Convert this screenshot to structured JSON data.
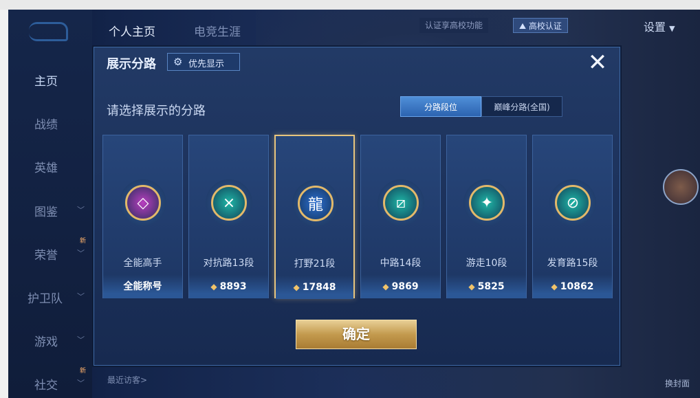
{
  "sidebar": {
    "items": [
      {
        "label": "主页"
      },
      {
        "label": "战绩"
      },
      {
        "label": "英雄"
      },
      {
        "label": "图鉴"
      },
      {
        "label": "荣誉",
        "badge": "新"
      },
      {
        "label": "护卫队"
      },
      {
        "label": "游戏"
      },
      {
        "label": "社交",
        "badge": "新"
      }
    ]
  },
  "header": {
    "tabs": [
      "个人主页",
      "电竞生涯"
    ],
    "campus_text": "认证享高校功能",
    "campus_button": "高校认证",
    "settings_label": "设置"
  },
  "footer": {
    "recent_visitors": "最近访客>",
    "change_cover": "换封面"
  },
  "modal": {
    "title": "展示分路",
    "priority_label": "优先显示",
    "prompt": "请选择展示的分路",
    "segments": {
      "active": "分路段位",
      "inactive": "巅峰分路(全国)"
    },
    "confirm_label": "确定",
    "cards": [
      {
        "name": "全能高手",
        "value": "全能称号",
        "has_points_icon": false,
        "emblem_color": "#b83fbf",
        "glyph": "◇"
      },
      {
        "name": "对抗路13段",
        "value": "8893",
        "has_points_icon": true,
        "emblem_color": "#1fb6a6",
        "glyph": "⨯"
      },
      {
        "name": "打野21段",
        "value": "17848",
        "has_points_icon": true,
        "emblem_color": "#2c6fd0",
        "glyph": "龍",
        "selected": true
      },
      {
        "name": "中路14段",
        "value": "9869",
        "has_points_icon": true,
        "emblem_color": "#1fb6a6",
        "glyph": "⧄"
      },
      {
        "name": "游走10段",
        "value": "5825",
        "has_points_icon": true,
        "emblem_color": "#1fb6a6",
        "glyph": "✦"
      },
      {
        "name": "发育路15段",
        "value": "10862",
        "has_points_icon": true,
        "emblem_color": "#1fb6a6",
        "glyph": "⊘"
      }
    ]
  }
}
